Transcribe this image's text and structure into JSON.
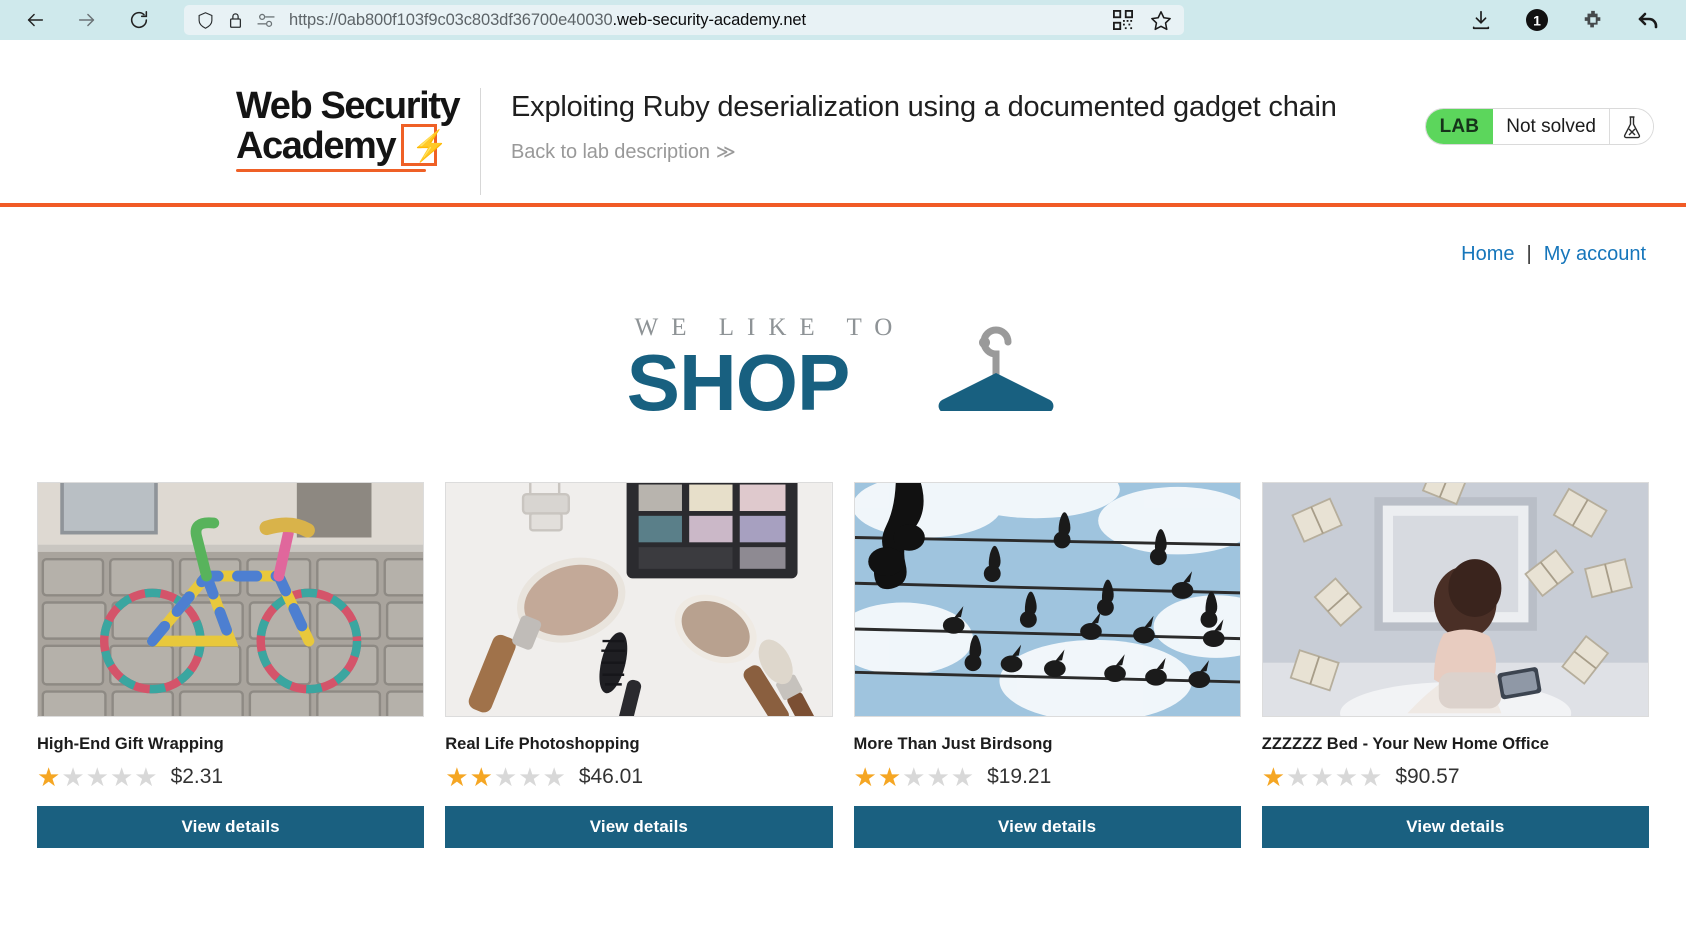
{
  "browser": {
    "url_prefix": "https://0ab800f103f9c03c803df36700e40030",
    "url_host": ".web-security-academy.net",
    "icons": {
      "back": "back-arrow-icon",
      "forward": "forward-arrow-icon",
      "reload": "reload-icon",
      "shield": "shield-icon",
      "lock": "lock-icon",
      "permissions": "permissions-icon",
      "qr": "qr-code-icon",
      "bookmark": "star-bookmark-icon",
      "download": "download-icon",
      "account_badge": "badge-one-icon",
      "extension": "extension-icon",
      "undo": "undo-arrow-icon"
    },
    "badge_count": "1"
  },
  "lab": {
    "logo_line1": "Web Security",
    "logo_line2": "Academy",
    "title": "Exploiting Ruby deserialization using a documented gadget chain",
    "back_link": "Back to lab description",
    "back_link_chevron": "≫",
    "status_tag": "LAB",
    "status_state": "Not solved",
    "flask_icon": "flask-x-icon"
  },
  "nav": {
    "home": "Home",
    "separator": "|",
    "my_account": "My account"
  },
  "banner": {
    "tagline": "WE LIKE TO",
    "word": "SHOP",
    "hanger_icon": "clothes-hanger-icon"
  },
  "products": [
    {
      "title": "High-End Gift Wrapping",
      "price": "$2.31",
      "rating": 1,
      "image": "knitted-bicycle",
      "button": "View details"
    },
    {
      "title": "Real Life Photoshopping",
      "price": "$46.01",
      "rating": 2,
      "image": "makeup-brushes",
      "button": "View details"
    },
    {
      "title": "More Than Just Birdsong",
      "price": "$19.21",
      "rating": 2,
      "image": "birds-on-wires",
      "button": "View details"
    },
    {
      "title": "ZZZZZZ Bed - Your New Home Office",
      "price": "$90.57",
      "rating": 1,
      "image": "flying-books-bedroom",
      "button": "View details"
    }
  ],
  "colors": {
    "accent_orange": "#f15b26",
    "brand_teal": "#186080",
    "link_blue": "#1676bb",
    "lab_green": "#5cd65c",
    "star_gold": "#f5a623"
  }
}
